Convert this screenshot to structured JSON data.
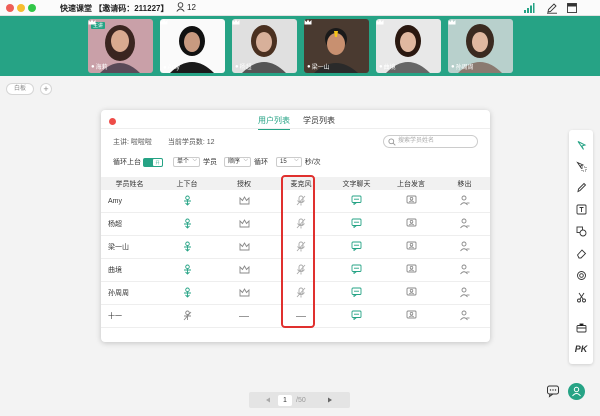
{
  "window": {
    "title": "快速课堂 【邀请码：211227】",
    "user_count": "12",
    "colors": {
      "accent": "#26a385",
      "close_red": "#ee4c48",
      "highlight_red": "#e0302e"
    }
  },
  "video_tiles": [
    {
      "name": "海莉",
      "tag": "主讲",
      "bg": "#c9a0a8",
      "skin": "#d9aa90",
      "hair": "#3a2520"
    },
    {
      "name": "Amy",
      "tag": "",
      "bg": "#fafafa",
      "skin": "#c89a80",
      "hair": "#111111"
    },
    {
      "name": "杨超",
      "tag": "",
      "bg": "#e0e0e0",
      "skin": "#d8b09a",
      "hair": "#4a3020"
    },
    {
      "name": "梁一山",
      "tag": "",
      "bg": "#4a3a30",
      "skin": "#c89070",
      "hair": "#1a1a1a"
    },
    {
      "name": "曲境",
      "tag": "",
      "bg": "#e8e8e8",
      "skin": "#e0b8a0",
      "hair": "#2a1810"
    },
    {
      "name": "孙周周",
      "tag": "",
      "bg": "#b8d0cc",
      "skin": "#e0b8a0",
      "hair": "#3a2a20"
    }
  ],
  "whiteboard": {
    "tab_label": "白板",
    "add_label": "+"
  },
  "dialog": {
    "tabs": [
      "用户列表",
      "学员列表"
    ],
    "teacher_label": "主讲:",
    "teacher_name": "啦啦啦",
    "count_label": "当前学员数:",
    "count_value": "12",
    "search_placeholder": "搜索学员姓名",
    "rotation_label": "循环上台",
    "toggle_text": "开",
    "per_value": "单个",
    "per_unit": "学员",
    "order_value": "顺序",
    "loop_label": "循环",
    "interval_value": "15",
    "interval_unit": "秒/次",
    "columns": [
      "学员姓名",
      "上下台",
      "授权",
      "麦克风",
      "文字聊天",
      "上台发言",
      "移出"
    ],
    "rows": [
      {
        "name": "Amy",
        "on_stage": true,
        "mic": "muted"
      },
      {
        "name": "杨超",
        "on_stage": true,
        "mic": "muted"
      },
      {
        "name": "梁一山",
        "on_stage": true,
        "mic": "muted"
      },
      {
        "name": "曲境",
        "on_stage": true,
        "mic": "muted"
      },
      {
        "name": "孙周周",
        "on_stage": true,
        "mic": "muted"
      },
      {
        "name": "十一",
        "on_stage": false,
        "mic": "none"
      }
    ]
  },
  "toolbar": {
    "tools": [
      "cursor-icon",
      "select-icon",
      "pen-icon",
      "text-icon",
      "shape-icon",
      "eraser-icon",
      "laser-icon",
      "scissors-icon",
      "toolbox-icon",
      "pk-icon"
    ],
    "pk_label": "PK"
  },
  "pager": {
    "current": "1",
    "total": "/50"
  }
}
